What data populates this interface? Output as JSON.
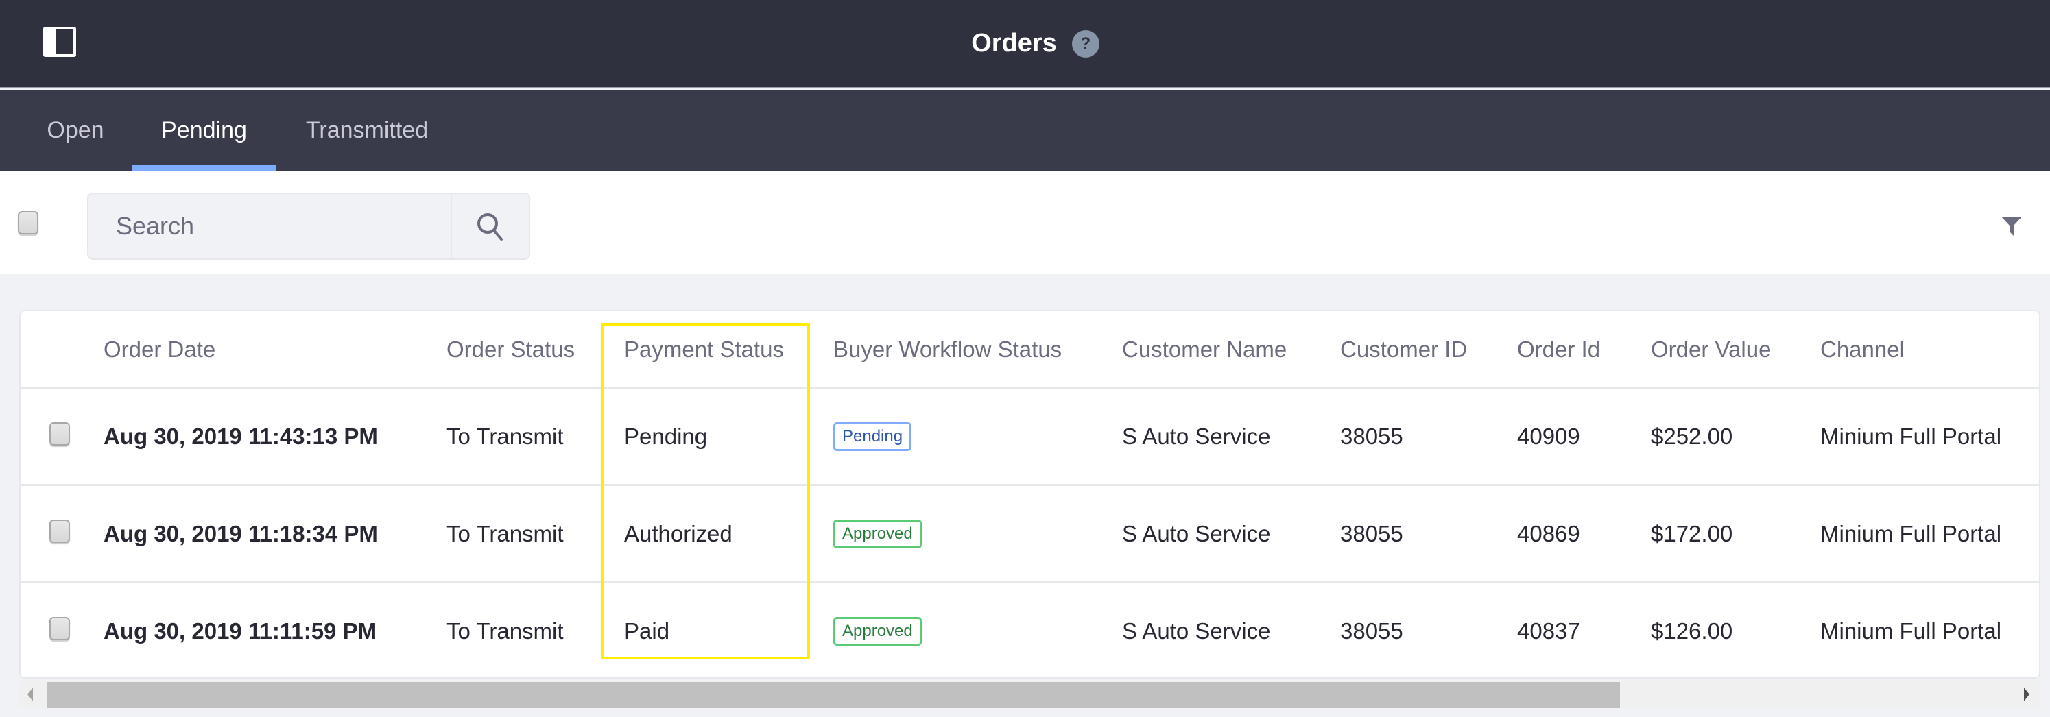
{
  "header": {
    "title": "Orders",
    "help_glyph": "?"
  },
  "tabs": [
    {
      "label": "Open",
      "active": false
    },
    {
      "label": "Pending",
      "active": true
    },
    {
      "label": "Transmitted",
      "active": false
    }
  ],
  "toolbar": {
    "search_placeholder": "Search",
    "search_value": ""
  },
  "table": {
    "columns": [
      "Order Date",
      "Order Status",
      "Payment Status",
      "Buyer Workflow Status",
      "Customer Name",
      "Customer ID",
      "Order Id",
      "Order Value",
      "Channel"
    ],
    "rows": [
      {
        "order_date": "Aug 30, 2019 11:43:13 PM",
        "order_status": "To Transmit",
        "payment_status": "Pending",
        "workflow_status": "Pending",
        "customer_name": "S Auto Service",
        "customer_id": "38055",
        "order_id": "40909",
        "order_value": "$252.00",
        "channel": "Minium Full Portal"
      },
      {
        "order_date": "Aug 30, 2019 11:18:34 PM",
        "order_status": "To Transmit",
        "payment_status": "Authorized",
        "workflow_status": "Approved",
        "customer_name": "S Auto Service",
        "customer_id": "38055",
        "order_id": "40869",
        "order_value": "$172.00",
        "channel": "Minium Full Portal"
      },
      {
        "order_date": "Aug 30, 2019 11:11:59 PM",
        "order_status": "To Transmit",
        "payment_status": "Paid",
        "workflow_status": "Approved",
        "customer_name": "S Auto Service",
        "customer_id": "38055",
        "order_id": "40837",
        "order_value": "$126.00",
        "channel": "Minium Full Portal"
      }
    ]
  },
  "colors": {
    "header_bg": "#30313f",
    "tab_bar_bg": "#393a4a",
    "tab_active_indicator": "#80acff",
    "badge_pending": "#2e5aac",
    "badge_pending_border": "#80acff",
    "badge_approved": "#287d3c",
    "badge_approved_border": "#5aca75",
    "highlight": "#ffec00"
  },
  "scrollbar": {
    "horizontal_scroll_position_fraction": 0.0,
    "visible_fraction": 0.8
  }
}
